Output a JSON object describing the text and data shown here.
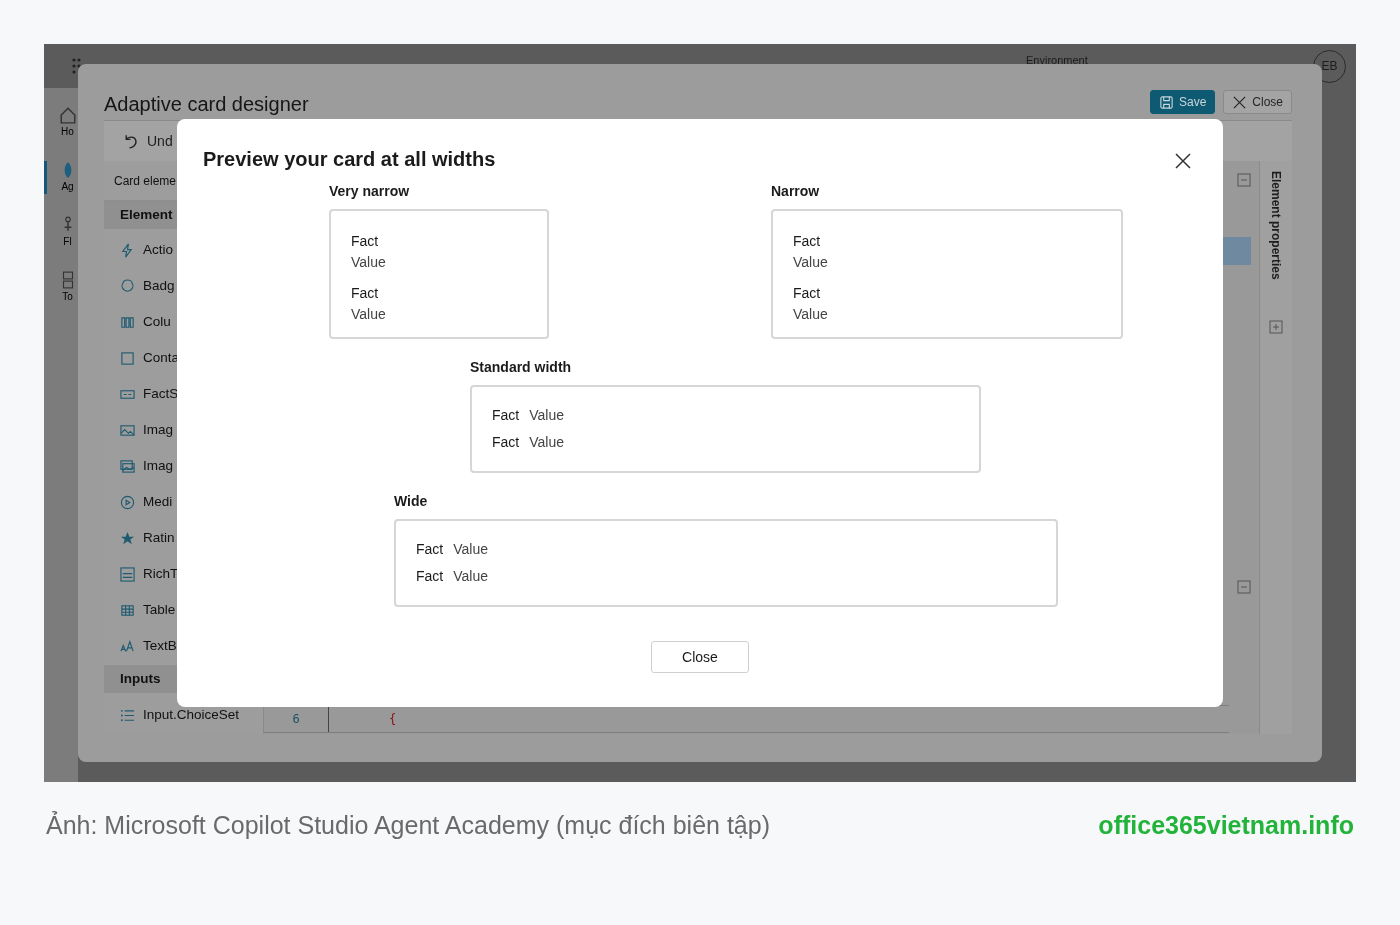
{
  "app": {
    "rail": [
      {
        "label": "Ho",
        "selected": false
      },
      {
        "label": "Ag",
        "selected": true
      },
      {
        "label": "Fl",
        "selected": false
      },
      {
        "label": "To",
        "selected": false
      }
    ],
    "environment": "Environment",
    "avatar": "EB"
  },
  "designer": {
    "title": "Adaptive card designer",
    "buttons": [
      {
        "kind": "save",
        "label": "Save"
      },
      {
        "kind": "close",
        "label": "Close"
      }
    ],
    "toolbar": [
      {
        "kind": "undo",
        "label": "Und"
      }
    ],
    "panel_title": "Card eleme",
    "sections": [
      {
        "title": "Element",
        "items": [
          {
            "kind": "bolt",
            "label": "Actio"
          },
          {
            "kind": "badge",
            "label": "Badg"
          },
          {
            "kind": "columns",
            "label": "Colu"
          },
          {
            "kind": "container",
            "label": "Conta"
          },
          {
            "kind": "factset",
            "label": "FactS"
          },
          {
            "kind": "image",
            "label": "Imag"
          },
          {
            "kind": "imageset",
            "label": "Imag"
          },
          {
            "kind": "media",
            "label": "Medi"
          },
          {
            "kind": "star",
            "label": "Ratin"
          },
          {
            "kind": "richtext",
            "label": "RichT"
          },
          {
            "kind": "table",
            "label": "Table"
          },
          {
            "kind": "textblock",
            "label": "TextB"
          }
        ]
      },
      {
        "title": "Inputs",
        "items": [
          {
            "kind": "list",
            "label": "Input.ChoiceSet"
          }
        ]
      }
    ],
    "code": {
      "line_number": "6",
      "text": "{"
    },
    "properties_label": "Element properties"
  },
  "modal": {
    "title": "Preview your card at all widths",
    "previews": [
      {
        "label": "Very narrow",
        "kind": "stacked",
        "facts": [
          {
            "title": "Fact",
            "value": "Value"
          },
          {
            "title": "Fact",
            "value": "Value"
          }
        ]
      },
      {
        "label": "Narrow",
        "kind": "stacked",
        "facts": [
          {
            "title": "Fact",
            "value": "Value"
          },
          {
            "title": "Fact",
            "value": "Value"
          }
        ]
      },
      {
        "label": "Standard width",
        "kind": "inline",
        "facts": [
          {
            "title": "Fact",
            "value": "Value"
          },
          {
            "title": "Fact",
            "value": "Value"
          }
        ]
      },
      {
        "label": "Wide",
        "kind": "inline",
        "facts": [
          {
            "title": "Fact",
            "value": "Value"
          },
          {
            "title": "Fact",
            "value": "Value"
          }
        ]
      }
    ],
    "close_button": "Close"
  },
  "caption": {
    "text": "Ảnh: Microsoft Copilot Studio Agent Academy (mục đích biên tập)",
    "site": "office365vietnam.info"
  }
}
